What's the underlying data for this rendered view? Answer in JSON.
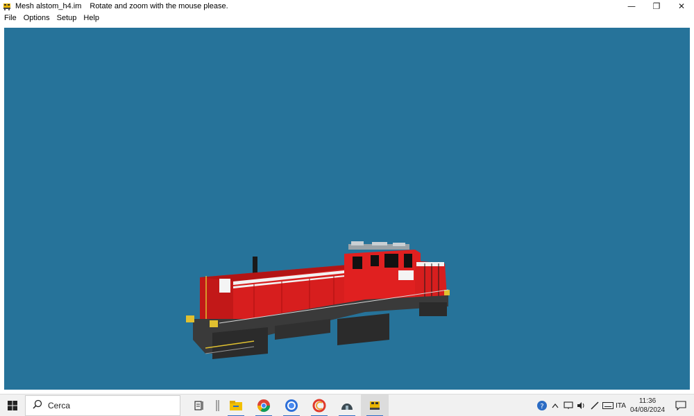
{
  "window": {
    "title": "Mesh alstom_h4.im",
    "hint": "Rotate and zoom with the mouse please.",
    "icon": "locomotive-icon",
    "controls": {
      "minimize": "—",
      "restore": "❐",
      "close": "✕"
    }
  },
  "menu": {
    "items": [
      {
        "label": "File"
      },
      {
        "label": "Options"
      },
      {
        "label": "Setup"
      },
      {
        "label": "Help"
      }
    ]
  },
  "viewport": {
    "background": "#26739a",
    "model": {
      "body_color": "#d71e1e",
      "chassis_color": "#3a3a3a",
      "accent_color": "#e0c030"
    }
  },
  "taskbar": {
    "search_placeholder": "Cerca",
    "apps": [
      "task-view-icon",
      "divider-icon",
      "file-explorer-icon",
      "chrome-icon",
      "firefox-icon",
      "ccleaner-icon",
      "app-dome-icon",
      "mesh-viewer-icon"
    ],
    "tray": {
      "language": "ITA",
      "time": "11:36",
      "date": "04/08/2024"
    }
  }
}
